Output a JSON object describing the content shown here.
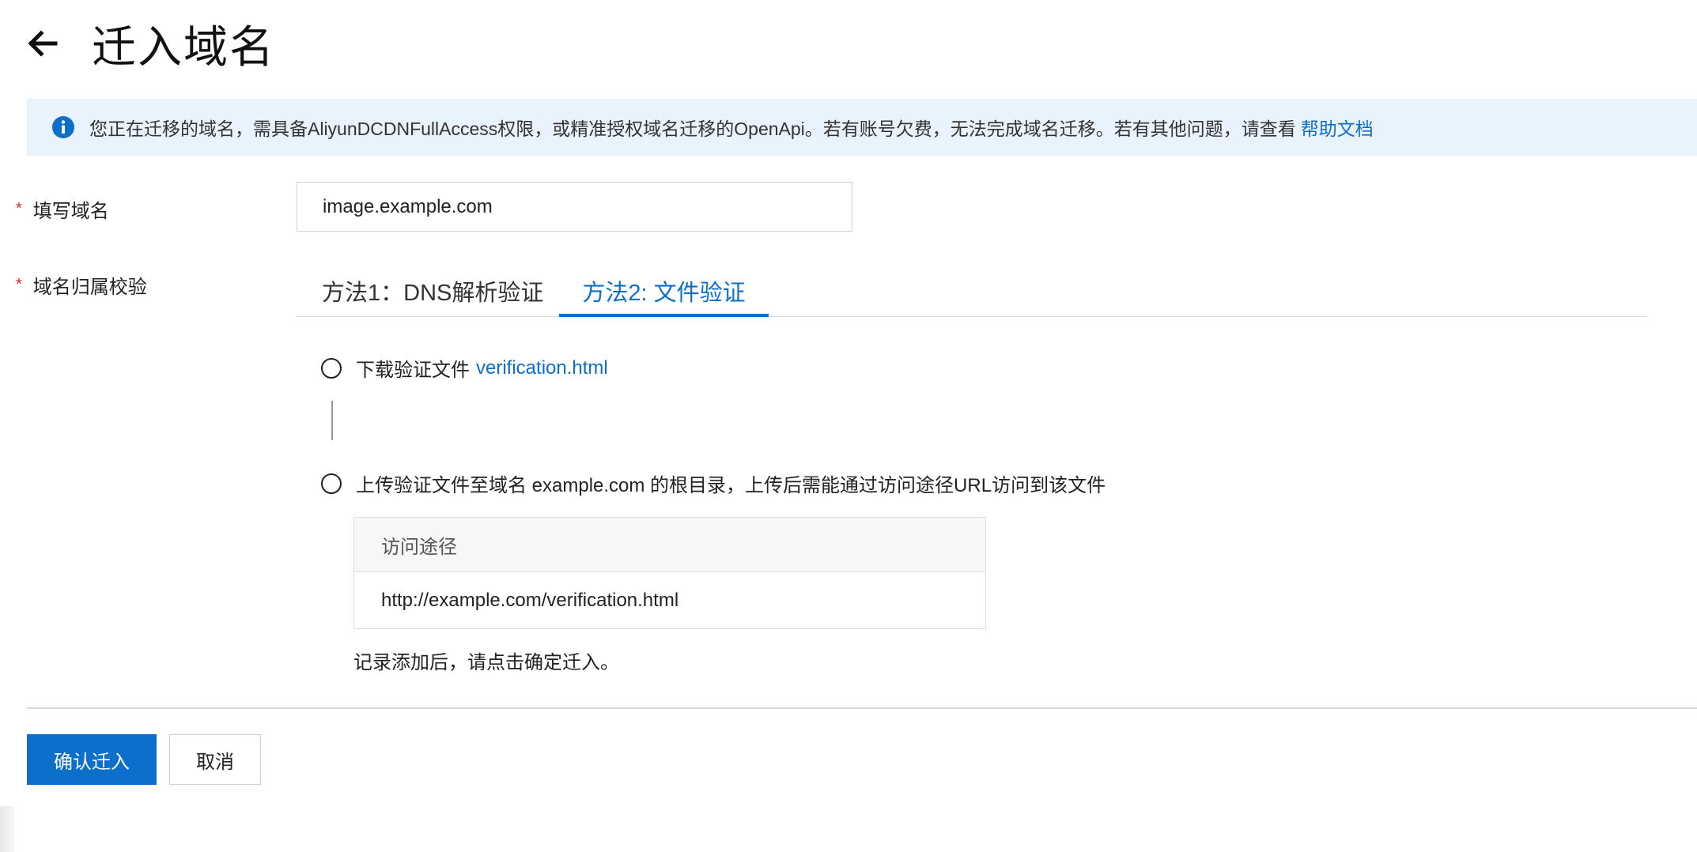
{
  "header": {
    "title": "迁入域名"
  },
  "notice": {
    "text": "您正在迁移的域名，需具备AliyunDCDNFullAccess权限，或精准授权域名迁移的OpenApi。若有账号欠费，无法完成域名迁移。若有其他问题，请查看",
    "link_label": "帮助文档",
    "icon": "info-icon"
  },
  "form": {
    "required_mark": "*",
    "domain_label": "填写域名",
    "domain_value": "image.example.com",
    "verify_label": "域名归属校验"
  },
  "tabs": [
    {
      "label": "方法1：DNS解析验证",
      "active": false
    },
    {
      "label": "方法2: 文件验证",
      "active": true
    }
  ],
  "steps": {
    "download_text": "下载验证文件",
    "download_link": "verification.html",
    "upload_text": "上传验证文件至域名 example.com 的根目录，上传后需能通过访问途径URL访问到该文件"
  },
  "path_table": {
    "header": "访问途径",
    "value": "http://example.com/verification.html"
  },
  "hint": "记录添加后，请点击确定迁入。",
  "buttons": {
    "confirm": "确认迁入",
    "cancel": "取消"
  },
  "colors": {
    "accent": "#0b6fcb",
    "notice_bg": "#e8f3fd",
    "required": "#d9272e"
  }
}
